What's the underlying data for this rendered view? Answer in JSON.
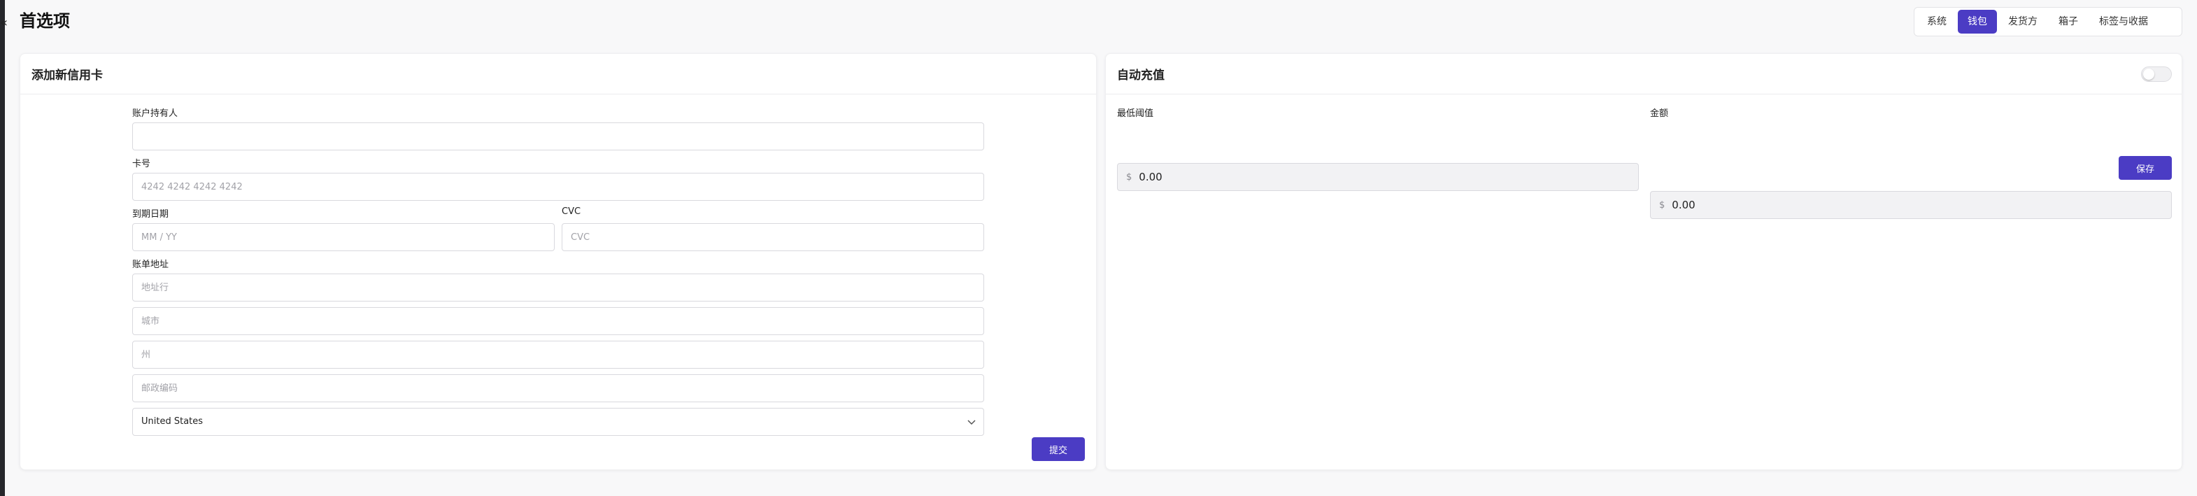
{
  "page": {
    "title": "首选项"
  },
  "nav": {
    "collapse_glyph": "«"
  },
  "tabs": [
    {
      "label": "系统",
      "active": false
    },
    {
      "label": "钱包",
      "active": true
    },
    {
      "label": "发货方",
      "active": false
    },
    {
      "label": "箱子",
      "active": false
    },
    {
      "label": "标签与收据",
      "active": false
    }
  ],
  "card_form": {
    "title": "添加新信用卡",
    "cardholder": {
      "label": "账户持有人",
      "value": "",
      "placeholder": ""
    },
    "card_number": {
      "label": "卡号",
      "value": "",
      "placeholder": "4242 4242 4242 4242"
    },
    "expiry": {
      "label": "到期日期",
      "value": "",
      "placeholder": "MM / YY"
    },
    "cvc": {
      "label": "CVC",
      "value": "",
      "placeholder": "CVC"
    },
    "billing": {
      "label": "账单地址",
      "line_placeholder": "地址行",
      "city_placeholder": "城市",
      "state_placeholder": "州",
      "zip_placeholder": "邮政编码",
      "country": "United States"
    },
    "submit_label": "提交"
  },
  "auto_recharge": {
    "title": "自动充值",
    "enabled": false,
    "threshold": {
      "label": "最低阈值",
      "currency": "$",
      "value": "0.00"
    },
    "amount": {
      "label": "金额",
      "currency": "$",
      "value": "0.00"
    },
    "save_label": "保存"
  },
  "colors": {
    "accent": "#4b3cc4",
    "rail": "#26272b"
  }
}
